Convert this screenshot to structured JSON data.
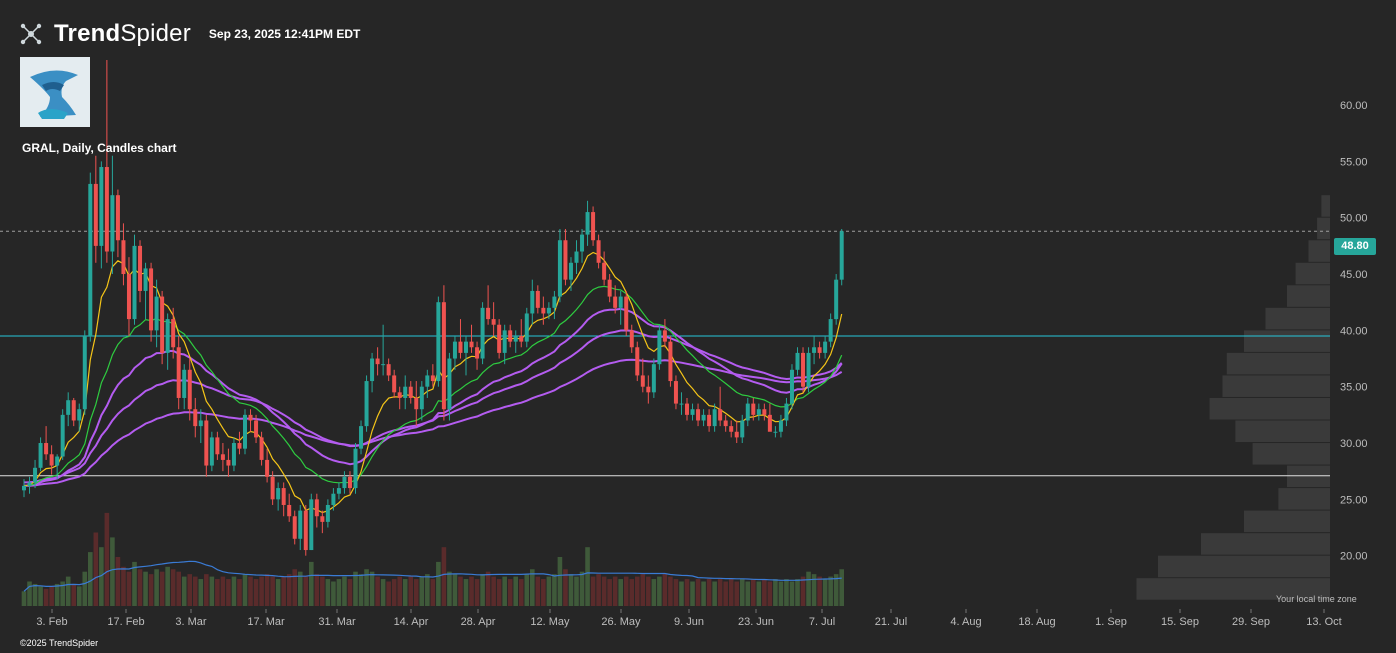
{
  "header": {
    "brand_bold": "Trend",
    "brand_light": "Spider",
    "timestamp": "Sep 23, 2025 12:41PM EDT",
    "symbol_line": "GRAL, Daily, Candles chart",
    "copyright": "©2025 TrendSpider",
    "timezone_note": "Your local time zone"
  },
  "colors": {
    "background": "#262626",
    "up": "#26a69a",
    "down": "#ef5350",
    "ema_fast": "#f5c518",
    "ema_mid": "#2ecc40",
    "ema_slow": "#b45cf0",
    "hline": "#26c6da",
    "volume_ma": "#3a7bd5"
  },
  "chart_data": {
    "type": "candlestick",
    "symbol": "GRAL",
    "interval": "Daily",
    "last_price": 48.8,
    "ylim": [
      15,
      64
    ],
    "y_ticks": [
      20,
      25,
      30,
      35,
      40,
      45,
      50,
      55,
      60
    ],
    "y_tick_labels": [
      "20.00",
      "25.00",
      "30.00",
      "35.00",
      "40.00",
      "45.00",
      "50.00",
      "55.00",
      "60.00"
    ],
    "x_tick_labels": [
      "3. Feb",
      "17. Feb",
      "3. Mar",
      "17. Mar",
      "31. Mar",
      "14. Apr",
      "28. Apr",
      "12. May",
      "26. May",
      "9. Jun",
      "23. Jun",
      "7. Jul",
      "21. Jul",
      "4. Aug",
      "18. Aug",
      "1. Sep",
      "15. Sep",
      "29. Sep",
      "13. Oct"
    ],
    "horizontal_lines": [
      39.5,
      27.1
    ],
    "candles_ohlc": [
      [
        25.8,
        26.8,
        25.2,
        26.2
      ],
      [
        26.2,
        27.0,
        25.5,
        26.5
      ],
      [
        26.5,
        28.5,
        26.0,
        27.8
      ],
      [
        27.8,
        30.5,
        27.5,
        30.0
      ],
      [
        30.0,
        31.5,
        28.5,
        29.0
      ],
      [
        29.0,
        29.8,
        27.2,
        28.0
      ],
      [
        28.0,
        29.0,
        26.8,
        28.8
      ],
      [
        28.8,
        33.0,
        28.5,
        32.5
      ],
      [
        32.5,
        34.5,
        31.5,
        33.8
      ],
      [
        33.8,
        34.0,
        31.5,
        32.0
      ],
      [
        32.0,
        33.5,
        31.0,
        33.0
      ],
      [
        33.0,
        40.0,
        32.5,
        39.5
      ],
      [
        39.5,
        54.0,
        39.0,
        53.0
      ],
      [
        53.0,
        55.5,
        46.0,
        47.5
      ],
      [
        47.5,
        55.0,
        45.5,
        54.5
      ],
      [
        54.5,
        64.0,
        46.0,
        47.0
      ],
      [
        47.0,
        55.5,
        45.0,
        52.0
      ],
      [
        52.0,
        52.5,
        46.5,
        48.0
      ],
      [
        48.0,
        49.5,
        44.0,
        45.0
      ],
      [
        45.0,
        46.5,
        39.5,
        41.0
      ],
      [
        41.0,
        48.5,
        40.5,
        47.5
      ],
      [
        47.5,
        48.0,
        42.5,
        43.5
      ],
      [
        43.5,
        46.0,
        41.0,
        45.5
      ],
      [
        45.5,
        46.0,
        39.0,
        40.0
      ],
      [
        40.0,
        44.5,
        38.5,
        43.0
      ],
      [
        43.0,
        43.5,
        37.0,
        38.0
      ],
      [
        38.0,
        41.5,
        36.5,
        41.0
      ],
      [
        41.0,
        42.0,
        37.5,
        38.5
      ],
      [
        38.5,
        39.5,
        33.0,
        34.0
      ],
      [
        34.0,
        37.0,
        33.0,
        36.5
      ],
      [
        36.5,
        37.5,
        32.0,
        33.0
      ],
      [
        33.0,
        34.0,
        30.5,
        31.5
      ],
      [
        31.5,
        33.0,
        30.0,
        32.0
      ],
      [
        32.0,
        32.5,
        27.0,
        28.0
      ],
      [
        28.0,
        31.0,
        27.5,
        30.5
      ],
      [
        30.5,
        31.0,
        28.5,
        29.0
      ],
      [
        29.0,
        30.0,
        27.5,
        28.5
      ],
      [
        28.5,
        29.5,
        27.0,
        28.0
      ],
      [
        28.0,
        30.5,
        27.5,
        30.0
      ],
      [
        30.0,
        31.0,
        29.0,
        29.5
      ],
      [
        29.5,
        33.0,
        29.0,
        32.5
      ],
      [
        32.5,
        33.0,
        31.0,
        32.0
      ],
      [
        32.0,
        32.5,
        30.0,
        30.5
      ],
      [
        30.5,
        31.0,
        28.0,
        28.5
      ],
      [
        28.5,
        29.5,
        26.5,
        27.0
      ],
      [
        27.0,
        27.5,
        24.5,
        25.0
      ],
      [
        25.0,
        26.5,
        24.0,
        26.0
      ],
      [
        26.0,
        26.5,
        23.5,
        24.5
      ],
      [
        24.5,
        25.5,
        23.0,
        23.5
      ],
      [
        23.5,
        24.0,
        21.0,
        21.5
      ],
      [
        21.5,
        24.5,
        20.5,
        24.0
      ],
      [
        24.0,
        24.5,
        20.0,
        20.5
      ],
      [
        20.5,
        25.5,
        20.5,
        25.0
      ],
      [
        25.0,
        25.5,
        22.5,
        23.5
      ],
      [
        23.5,
        24.0,
        22.0,
        23.0
      ],
      [
        23.0,
        25.0,
        22.5,
        24.5
      ],
      [
        24.5,
        26.0,
        24.0,
        25.5
      ],
      [
        25.5,
        26.5,
        25.0,
        26.0
      ],
      [
        26.0,
        27.5,
        25.5,
        27.0
      ],
      [
        27.0,
        27.5,
        25.5,
        26.0
      ],
      [
        26.0,
        30.0,
        25.5,
        29.5
      ],
      [
        29.5,
        32.0,
        29.0,
        31.5
      ],
      [
        31.5,
        36.0,
        31.0,
        35.5
      ],
      [
        35.5,
        38.0,
        34.5,
        37.5
      ],
      [
        37.5,
        38.5,
        36.0,
        37.0
      ],
      [
        37.0,
        40.5,
        36.0,
        37.0
      ],
      [
        37.0,
        37.5,
        35.5,
        36.0
      ],
      [
        36.0,
        36.5,
        34.0,
        34.5
      ],
      [
        34.5,
        35.0,
        33.0,
        34.0
      ],
      [
        34.0,
        36.0,
        33.0,
        35.0
      ],
      [
        35.0,
        35.5,
        33.5,
        34.0
      ],
      [
        34.0,
        35.5,
        31.5,
        33.0
      ],
      [
        33.0,
        35.5,
        32.0,
        35.0
      ],
      [
        35.0,
        36.5,
        34.0,
        36.0
      ],
      [
        36.0,
        37.0,
        35.0,
        35.5
      ],
      [
        35.5,
        43.0,
        35.0,
        42.5
      ],
      [
        42.5,
        44.0,
        32.0,
        33.0
      ],
      [
        33.0,
        38.0,
        32.0,
        37.5
      ],
      [
        37.5,
        39.5,
        36.5,
        39.0
      ],
      [
        39.0,
        41.0,
        37.5,
        38.0
      ],
      [
        38.0,
        39.5,
        36.0,
        39.0
      ],
      [
        39.0,
        40.5,
        38.0,
        38.5
      ],
      [
        38.5,
        39.0,
        36.5,
        37.5
      ],
      [
        37.5,
        42.5,
        37.0,
        42.0
      ],
      [
        42.0,
        44.0,
        40.5,
        41.0
      ],
      [
        41.0,
        42.5,
        39.5,
        40.5
      ],
      [
        40.5,
        41.0,
        37.5,
        38.0
      ],
      [
        38.0,
        40.5,
        37.0,
        40.0
      ],
      [
        40.0,
        40.5,
        38.5,
        39.0
      ],
      [
        39.0,
        40.0,
        38.0,
        39.5
      ],
      [
        39.5,
        41.0,
        38.5,
        39.0
      ],
      [
        39.0,
        42.0,
        38.5,
        41.5
      ],
      [
        41.5,
        44.5,
        40.5,
        43.5
      ],
      [
        43.5,
        44.0,
        41.5,
        42.0
      ],
      [
        42.0,
        43.0,
        40.5,
        41.5
      ],
      [
        41.5,
        42.5,
        41.0,
        42.0
      ],
      [
        42.0,
        43.5,
        41.0,
        43.0
      ],
      [
        43.0,
        49.0,
        42.5,
        48.0
      ],
      [
        48.0,
        49.0,
        44.0,
        44.5
      ],
      [
        44.5,
        46.5,
        43.5,
        46.0
      ],
      [
        46.0,
        48.0,
        45.0,
        47.0
      ],
      [
        47.0,
        49.0,
        46.0,
        48.5
      ],
      [
        48.5,
        51.5,
        47.5,
        50.5
      ],
      [
        50.5,
        51.0,
        47.5,
        48.0
      ],
      [
        48.0,
        48.5,
        45.5,
        46.0
      ],
      [
        46.0,
        47.0,
        44.0,
        44.5
      ],
      [
        44.5,
        45.0,
        42.5,
        43.0
      ],
      [
        43.0,
        44.0,
        41.5,
        42.0
      ],
      [
        42.0,
        43.5,
        40.5,
        43.0
      ],
      [
        43.0,
        43.5,
        39.5,
        40.0
      ],
      [
        40.0,
        40.5,
        38.0,
        38.5
      ],
      [
        38.5,
        39.0,
        35.5,
        36.0
      ],
      [
        36.0,
        37.5,
        34.5,
        35.0
      ],
      [
        35.0,
        36.0,
        33.5,
        34.5
      ],
      [
        34.5,
        37.5,
        34.0,
        37.0
      ],
      [
        37.0,
        40.5,
        36.5,
        40.0
      ],
      [
        40.0,
        41.0,
        38.5,
        39.0
      ],
      [
        39.0,
        39.5,
        35.0,
        35.5
      ],
      [
        35.5,
        36.0,
        33.0,
        33.5
      ],
      [
        33.5,
        34.5,
        32.5,
        33.5
      ],
      [
        33.5,
        34.0,
        32.0,
        32.5
      ],
      [
        32.5,
        33.5,
        32.0,
        33.0
      ],
      [
        33.0,
        33.5,
        31.5,
        32.0
      ],
      [
        32.0,
        33.0,
        31.5,
        32.5
      ],
      [
        32.5,
        33.0,
        31.0,
        31.5
      ],
      [
        31.5,
        33.5,
        31.0,
        33.0
      ],
      [
        33.0,
        35.0,
        31.5,
        32.0
      ],
      [
        32.0,
        32.5,
        31.0,
        31.5
      ],
      [
        31.5,
        32.0,
        30.5,
        31.0
      ],
      [
        31.0,
        32.0,
        30.0,
        30.5
      ],
      [
        30.5,
        32.5,
        30.0,
        32.0
      ],
      [
        32.0,
        34.0,
        31.5,
        33.5
      ],
      [
        33.5,
        34.0,
        32.0,
        32.5
      ],
      [
        32.5,
        33.5,
        32.0,
        33.0
      ],
      [
        33.0,
        33.5,
        32.0,
        32.5
      ],
      [
        32.5,
        33.5,
        31.5,
        31.0
      ],
      [
        31.0,
        31.5,
        30.5,
        31.0
      ],
      [
        31.0,
        32.5,
        30.5,
        32.0
      ],
      [
        32.0,
        34.0,
        31.5,
        33.5
      ],
      [
        33.5,
        37.0,
        33.0,
        36.5
      ],
      [
        36.5,
        38.5,
        36.0,
        38.0
      ],
      [
        38.0,
        38.5,
        34.5,
        35.0
      ],
      [
        35.0,
        38.5,
        34.5,
        38.0
      ],
      [
        38.0,
        39.5,
        37.0,
        38.5
      ],
      [
        38.5,
        39.0,
        37.5,
        38.0
      ],
      [
        38.0,
        39.5,
        37.5,
        39.0
      ],
      [
        39.0,
        41.5,
        38.5,
        41.0
      ],
      [
        41.0,
        45.0,
        40.5,
        44.5
      ],
      [
        44.5,
        49.0,
        44.0,
        48.8
      ]
    ],
    "volumes": [
      6,
      10,
      9,
      8,
      7,
      8,
      9,
      10,
      12,
      9,
      8,
      14,
      22,
      30,
      24,
      38,
      28,
      20,
      16,
      14,
      18,
      15,
      14,
      13,
      15,
      14,
      16,
      15,
      14,
      12,
      13,
      12,
      11,
      13,
      12,
      11,
      12,
      11,
      12,
      11,
      13,
      12,
      11,
      12,
      13,
      12,
      11,
      12,
      13,
      15,
      14,
      12,
      18,
      13,
      12,
      11,
      10,
      11,
      12,
      11,
      14,
      13,
      15,
      14,
      12,
      11,
      10,
      11,
      12,
      11,
      12,
      11,
      12,
      13,
      11,
      18,
      24,
      14,
      13,
      12,
      11,
      12,
      11,
      13,
      14,
      12,
      11,
      12,
      11,
      12,
      11,
      13,
      15,
      12,
      11,
      12,
      13,
      20,
      15,
      13,
      12,
      14,
      24,
      12,
      13,
      12,
      11,
      12,
      11,
      12,
      11,
      12,
      13,
      12,
      11,
      12,
      13,
      12,
      11,
      10,
      11,
      10,
      11,
      10,
      11,
      10,
      11,
      10,
      11,
      10,
      11,
      10,
      11,
      10,
      11,
      10,
      11,
      10,
      11,
      10,
      11,
      12,
      14,
      13,
      12,
      11,
      12,
      13,
      15,
      17,
      20,
      18
    ]
  }
}
